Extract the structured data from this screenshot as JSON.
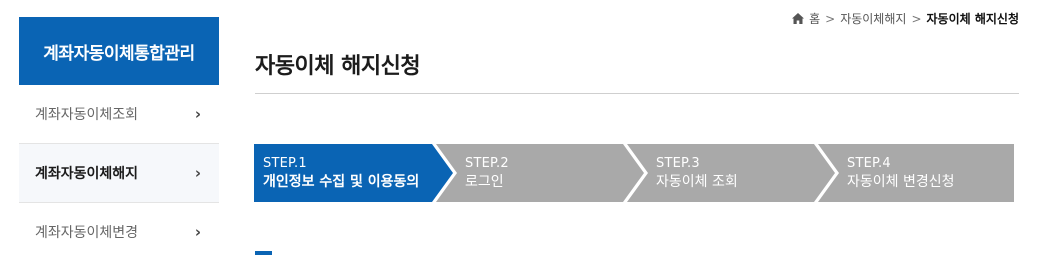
{
  "sidebar": {
    "title": "계좌자동이체통합관리",
    "items": [
      {
        "label": "계좌자동이체조회",
        "active": false
      },
      {
        "label": "계좌자동이체해지",
        "active": true
      },
      {
        "label": "계좌자동이체변경",
        "active": false
      }
    ]
  },
  "breadcrumb": {
    "home": "홈",
    "level1": "자동이체해지",
    "current": "자동이체 해지신청"
  },
  "page": {
    "title": "자동이체 해지신청"
  },
  "steps": [
    {
      "num": "STEP.1",
      "label": "개인정보 수집 및 이용동의",
      "active": true
    },
    {
      "num": "STEP.2",
      "label": "로그인",
      "active": false
    },
    {
      "num": "STEP.3",
      "label": "자동이체 조회",
      "active": false
    },
    {
      "num": "STEP.4",
      "label": "자동이체 변경신청",
      "active": false
    }
  ],
  "colors": {
    "brand": "#0a64b4",
    "step_inactive": "#a9a9a9",
    "step_separator": "#ffffff"
  }
}
